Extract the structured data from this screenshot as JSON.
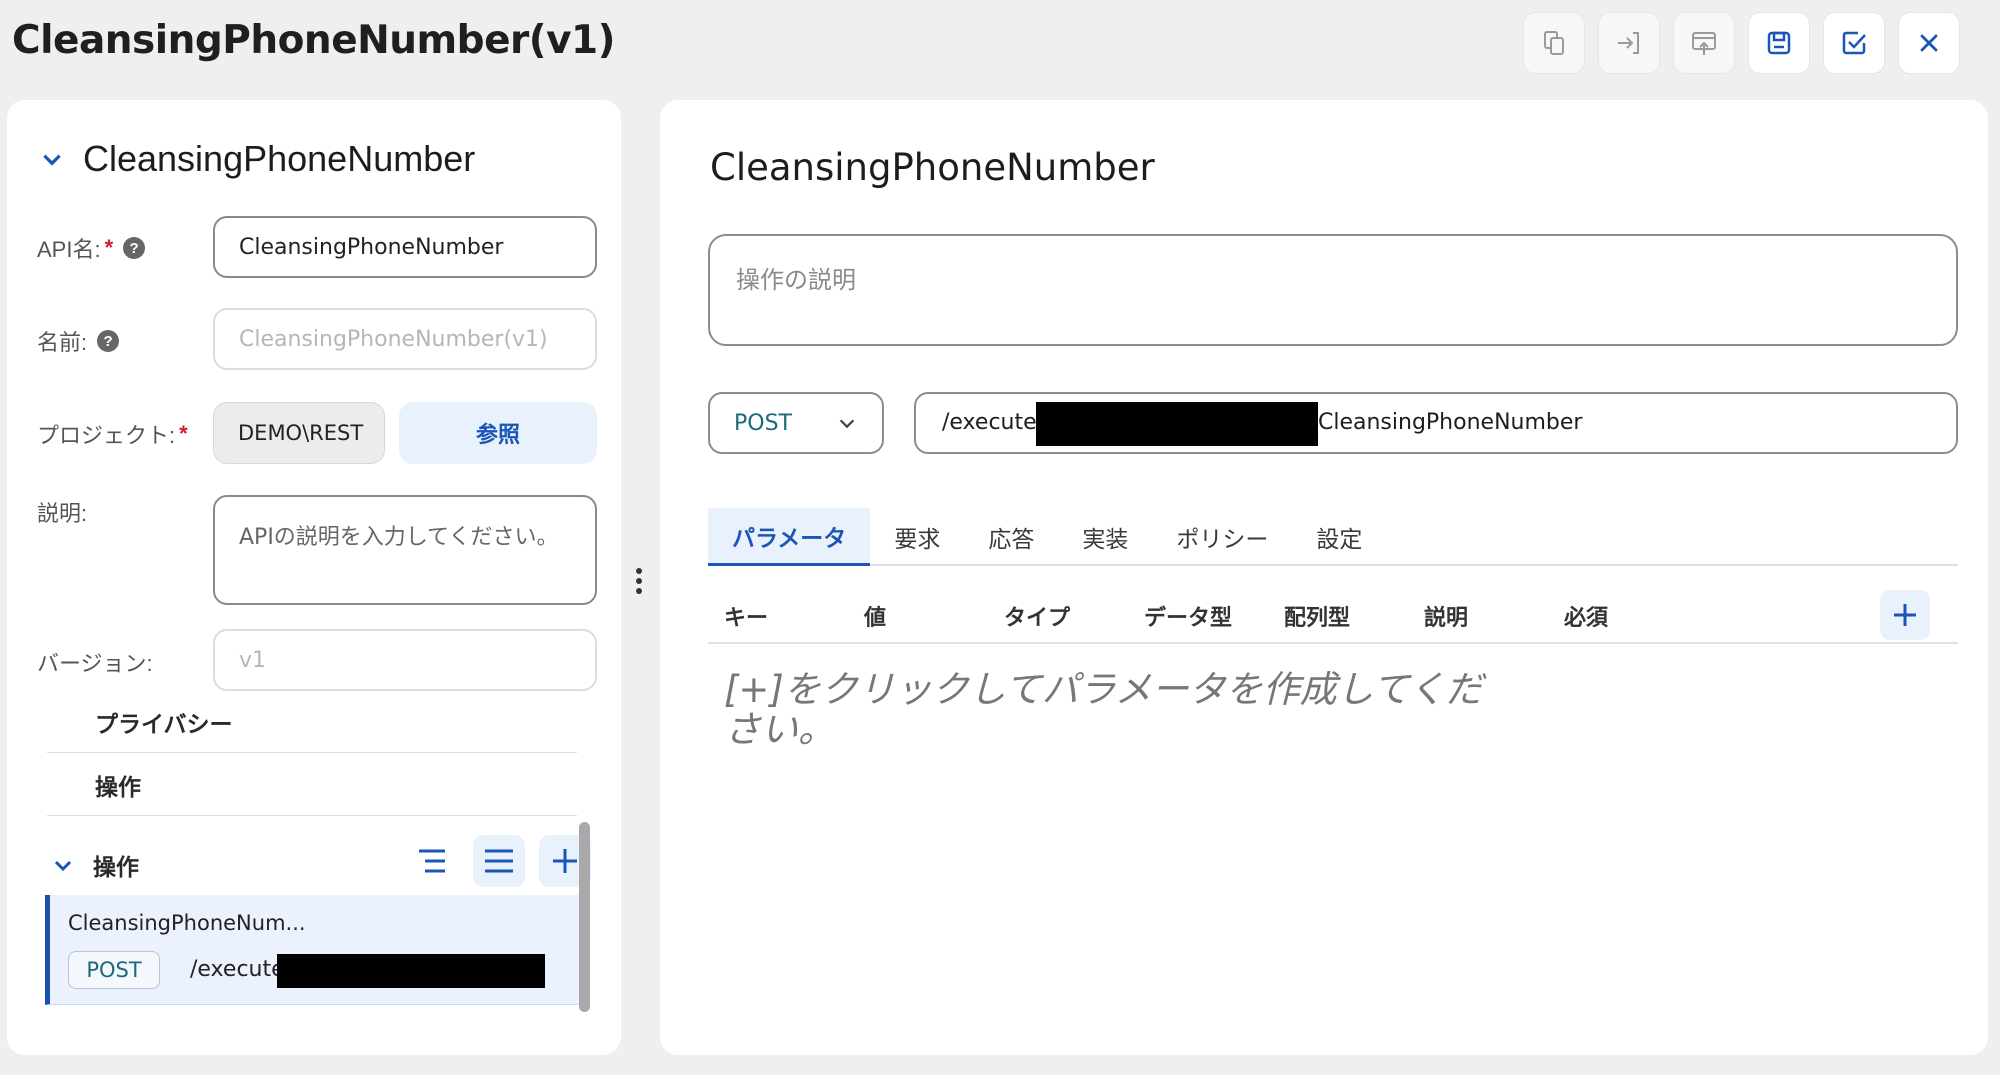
{
  "header": {
    "title": "CleansingPhoneNumber(v1)",
    "toolbar": [
      {
        "name": "copy-icon"
      },
      {
        "name": "import-icon"
      },
      {
        "name": "publish-icon"
      },
      {
        "name": "save-icon"
      },
      {
        "name": "validate-icon"
      },
      {
        "name": "close-icon"
      }
    ]
  },
  "colors": {
    "accent": "#1a56b5",
    "accent_bg": "#e9f1fc",
    "method": "#1a6a78",
    "required": "#d0202a"
  },
  "left": {
    "section_title": "CleansingPhoneNumber",
    "api_name": {
      "label": "API名:",
      "required": "*",
      "help": "?",
      "value": "CleansingPhoneNumber"
    },
    "name": {
      "label": "名前:",
      "help": "?",
      "value": "CleansingPhoneNumber(v1)"
    },
    "project": {
      "label": "プロジェクト:",
      "required": "*",
      "value": "DEMO\\REST",
      "browse_label": "参照"
    },
    "description": {
      "label": "説明:",
      "placeholder": "APIの説明を入力してください。"
    },
    "version": {
      "label": "バージョン:",
      "value": "v1"
    },
    "nav": [
      {
        "label": "プライバシー"
      },
      {
        "label": "操作"
      }
    ],
    "operations": {
      "label": "操作",
      "items": [
        {
          "name": "CleansingPhoneNum...",
          "method": "POST",
          "path": "/execute/"
        }
      ]
    }
  },
  "right": {
    "title": "CleansingPhoneNumber",
    "description_placeholder": "操作の説明",
    "method": "POST",
    "path_prefix": "/execute/",
    "path_suffix": "CleansingPhoneNumber",
    "tabs": [
      {
        "label": "パラメータ",
        "active": true
      },
      {
        "label": "要求"
      },
      {
        "label": "応答"
      },
      {
        "label": "実装"
      },
      {
        "label": "ポリシー"
      },
      {
        "label": "設定"
      }
    ],
    "columns": [
      "キー",
      "値",
      "タイプ",
      "データ型",
      "配列型",
      "説明",
      "必須"
    ],
    "empty_message": "[+]をクリックしてパラメータを作成してください。"
  }
}
